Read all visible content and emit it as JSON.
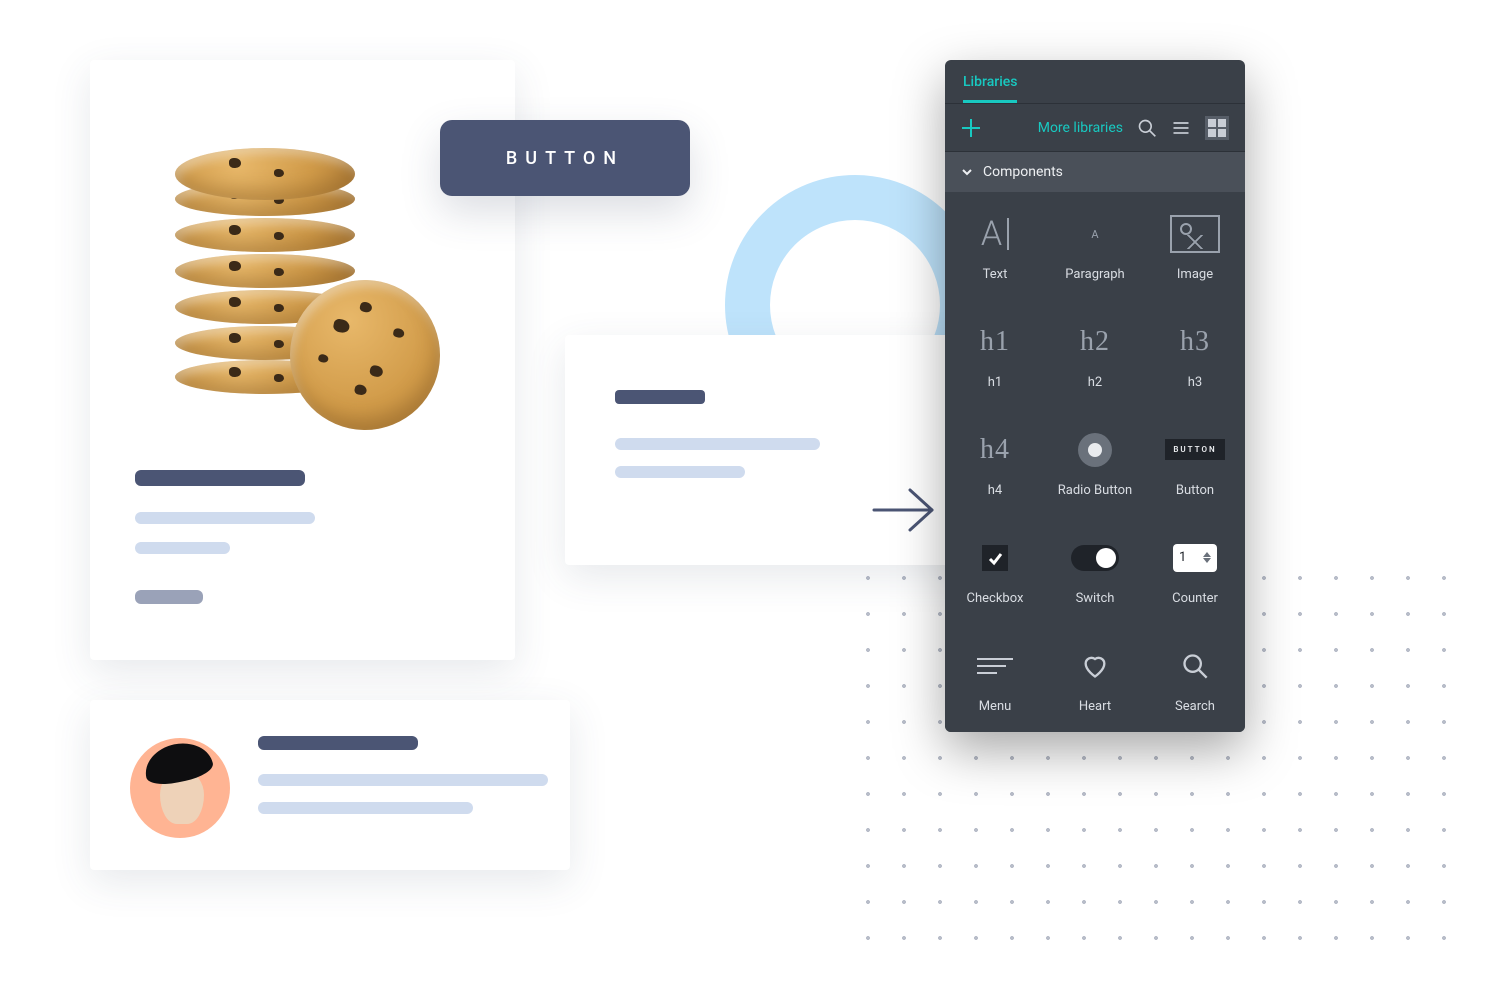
{
  "button_chip": {
    "label": "BUTTON"
  },
  "panel": {
    "tab_label": "Libraries",
    "more_libraries": "More libraries",
    "section_label": "Components",
    "components": [
      {
        "key": "text",
        "label": "Text"
      },
      {
        "key": "paragraph",
        "label": "Paragraph"
      },
      {
        "key": "image",
        "label": "Image"
      },
      {
        "key": "h1",
        "label": "h1",
        "glyph": "h1"
      },
      {
        "key": "h2",
        "label": "h2",
        "glyph": "h2"
      },
      {
        "key": "h3",
        "label": "h3",
        "glyph": "h3"
      },
      {
        "key": "h4",
        "label": "h4",
        "glyph": "h4"
      },
      {
        "key": "radio-button",
        "label": "Radio Button"
      },
      {
        "key": "button",
        "label": "Button",
        "glyph": "BUTTON"
      },
      {
        "key": "checkbox",
        "label": "Checkbox"
      },
      {
        "key": "switch",
        "label": "Switch"
      },
      {
        "key": "counter",
        "label": "Counter",
        "value": "1"
      },
      {
        "key": "menu",
        "label": "Menu"
      },
      {
        "key": "heart",
        "label": "Heart"
      },
      {
        "key": "search",
        "label": "Search"
      }
    ]
  }
}
